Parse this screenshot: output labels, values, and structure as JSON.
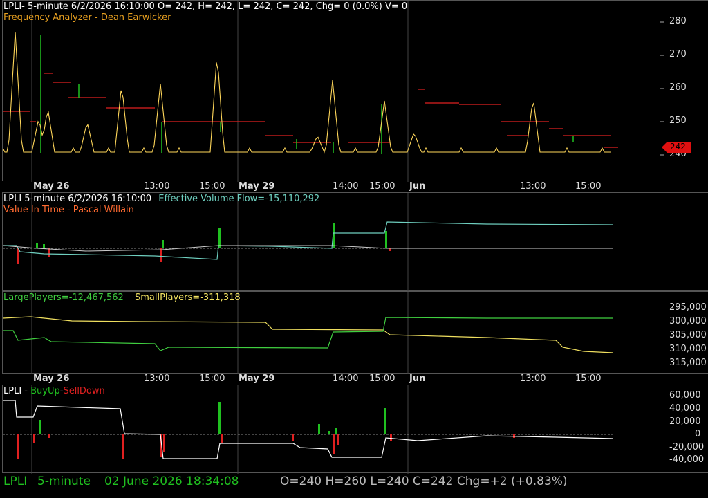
{
  "pane1": {
    "header": "LPLI- 5-minute 6/2/2026 16:10:00 O= 242, H= 242, L= 242, C= 242, Chg= 0 (0.0%) V= 0",
    "indicator": "Frequency Analyzer - Dean Earwicker",
    "ticks": [
      "280",
      "270",
      "260",
      "250",
      "240"
    ],
    "price_tag": "242",
    "colors": {
      "line": "#ffd75a",
      "red": "#e02020",
      "green": "#20c020",
      "tag": "#e01010"
    }
  },
  "dates_top": {
    "labels": [
      "May 26",
      "13:00",
      "15:00",
      "May 29",
      "14:00",
      "15:00",
      "Jun",
      "13:00",
      "15:00"
    ]
  },
  "pane2": {
    "header_left": "LPLI 5-minute  6/2/2026 16:10:00",
    "header_flow": "Effective Volume Flow=-15,110,292",
    "indicator": "Value In Time - Pascal Willain",
    "colors": {
      "flow": "#6fd0c0",
      "title": "#ff6a30"
    }
  },
  "pane3": {
    "large_label": "LargePlayers=-12,467,562",
    "small_label": "SmallPlayers=-311,318",
    "ticks": [
      "295,000",
      "300,000",
      "305,000",
      "310,000",
      "315,000"
    ],
    "colors": {
      "large": "#40d040",
      "small": "#f0e060"
    }
  },
  "dates_mid": {
    "labels": [
      "May 26",
      "13:00",
      "15:00",
      "May 29",
      "14:00",
      "15:00",
      "Jun",
      "13:00",
      "15:00"
    ]
  },
  "pane4": {
    "title_prefix": "LPLI - ",
    "title_buy": "BuyUp",
    "title_dash": "-",
    "title_sell": "SellDown",
    "ticks": [
      "60,000",
      "40,000",
      "20,000",
      "0",
      "-20,000",
      "-40,000"
    ]
  },
  "footer": {
    "symbol": "LPLI",
    "interval": "5-minute",
    "datetime": "02 June 2026 18:34:08",
    "ohlc": "O=240  H=260  L=240  C=242  Chg=+2 (+0.83%)"
  }
}
